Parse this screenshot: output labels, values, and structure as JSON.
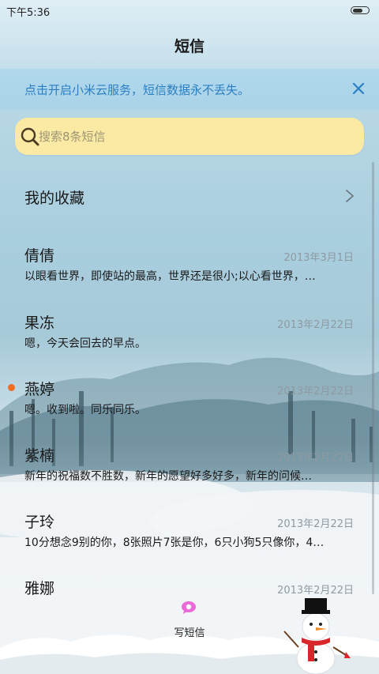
{
  "status_bar": {
    "time": "下午5:36",
    "battery_level": 0.7
  },
  "header": {
    "title": "短信"
  },
  "banner": {
    "text": "点击开启小米云服务，短信数据永不丢失。",
    "accent_color": "#2a7fc4"
  },
  "search": {
    "placeholder": "搜索8条短信"
  },
  "favorites": {
    "label": "我的收藏"
  },
  "threads": [
    {
      "name": "倩倩",
      "date": "2013年3月1日",
      "preview": "以眼看世界，即使站的最高，世界还是很小;以心看世界，…",
      "unread": false
    },
    {
      "name": "果冻",
      "date": "2013年2月22日",
      "preview": "嗯，今天会回去的早点。",
      "unread": false
    },
    {
      "name": "燕婷",
      "date": "2013年2月22日",
      "preview": "嗯。收到啦。同乐同乐。",
      "unread": true
    },
    {
      "name": "紫楠",
      "date": "2013年2月22日",
      "preview": "新年的祝福数不胜数，新年的愿望好多好多，新年的问候…",
      "unread": false
    },
    {
      "name": "子玲",
      "date": "2013年2月22日",
      "preview": "10分想念9别的你，8张照片7张是你，6只小狗5只像你，4…",
      "unread": false
    },
    {
      "name": "雅娜",
      "date": "2013年2月22日",
      "preview": "",
      "unread": false
    }
  ],
  "bottom_bar": {
    "compose_label": "写短信",
    "compose_icon": "chat-bubble-icon",
    "unread_color": "#f06c22",
    "search_bg_color": "#fbeaa4"
  }
}
